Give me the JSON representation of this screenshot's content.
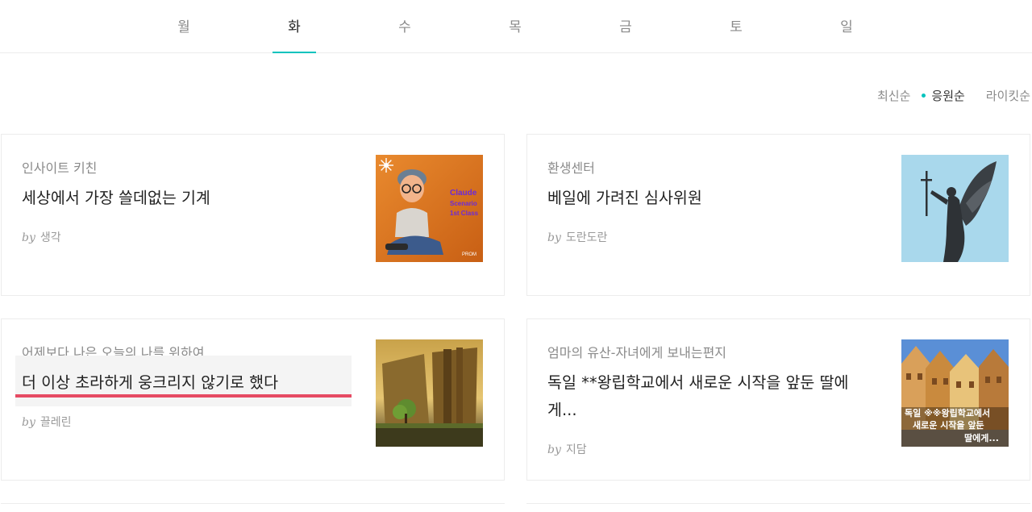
{
  "days": [
    {
      "label": "월",
      "active": false
    },
    {
      "label": "화",
      "active": true
    },
    {
      "label": "수",
      "active": false
    },
    {
      "label": "목",
      "active": false
    },
    {
      "label": "금",
      "active": false
    },
    {
      "label": "토",
      "active": false
    },
    {
      "label": "일",
      "active": false
    }
  ],
  "sort": {
    "latest": "최신순",
    "cheer": "응원순",
    "likeit": "라이킷순",
    "active": "응원순"
  },
  "author_prefix": "by",
  "cards": [
    {
      "magazine": "인사이트 키친",
      "title": "세상에서 가장 쓸데없는 기계",
      "author": "생각",
      "thumb_text": [
        "Claude",
        "Scenario",
        "1st Class"
      ],
      "thumb_brand": "PROM"
    },
    {
      "magazine": "환생센터",
      "title": "베일에 가려진 심사위원",
      "author": "도란도란"
    },
    {
      "magazine": "어제보다 나은 오늘의 나를 위하여",
      "title": "더 이상 초라하게 웅크리지 않기로 했다",
      "author": "끌레린"
    },
    {
      "magazine": "엄마의 유산-자녀에게 보내는편지",
      "title": "독일 **왕립학교에서 새로운 시작을 앞둔 딸에게...",
      "author": "지담",
      "thumb_text": [
        "독일 ※※왕립학교에서",
        "새로운 시작을 앞둔",
        "딸에게..."
      ]
    }
  ],
  "colors": {
    "accent": "#00c3bd",
    "highlight_underline": "#e64b63"
  }
}
